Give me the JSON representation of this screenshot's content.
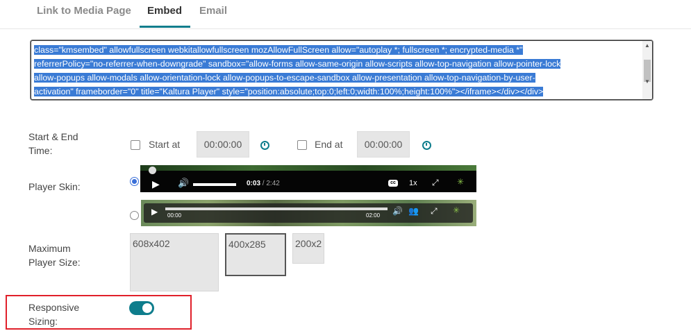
{
  "tabs": [
    {
      "label": "Link to Media Page"
    },
    {
      "label": "Embed"
    },
    {
      "label": "Email"
    }
  ],
  "embed_code": {
    "lines": [
      "class=\"kmsembed\" allowfullscreen webkitallowfullscreen mozAllowFullScreen allow=\"autoplay *; fullscreen *; encrypted-media *\"",
      "referrerPolicy=\"no-referrer-when-downgrade\" sandbox=\"allow-forms allow-same-origin allow-scripts allow-top-navigation allow-pointer-lock",
      "allow-popups allow-modals allow-orientation-lock allow-popups-to-escape-sandbox allow-presentation allow-top-navigation-by-user-",
      "activation\" frameborder=\"0\" title=\"Kaltura Player\" style=\"position:absolute;top:0;left:0;width:100%;height:100%\"></iframe></div></div>"
    ],
    "highlight_color": "#3a7bd5"
  },
  "start_end": {
    "label_line1": "Start & End",
    "label_line2": "Time:",
    "start_label": "Start at",
    "start_value": "00:00:00",
    "end_label": "End at",
    "end_value": "00:00:00",
    "start_checked": false,
    "end_checked": false
  },
  "player_skin": {
    "label": "Player Skin:",
    "skin1": {
      "time_current": "0:03",
      "time_total": "/ 2:42",
      "speed": "1x",
      "cc": "cc"
    },
    "skin2": {
      "time_start": "00:00",
      "time_end": "02:00"
    },
    "selected_index": 0
  },
  "max_size": {
    "label_line1": "Maximum",
    "label_line2": "Player Size:",
    "options": [
      "608x402",
      "400x285",
      "200x2"
    ],
    "selected": "400x285"
  },
  "responsive": {
    "label_line1": "Responsive",
    "label_line2": "Sizing:",
    "enabled": true,
    "accent": "#0e7d8c"
  },
  "annotation_color": "#e0202a"
}
